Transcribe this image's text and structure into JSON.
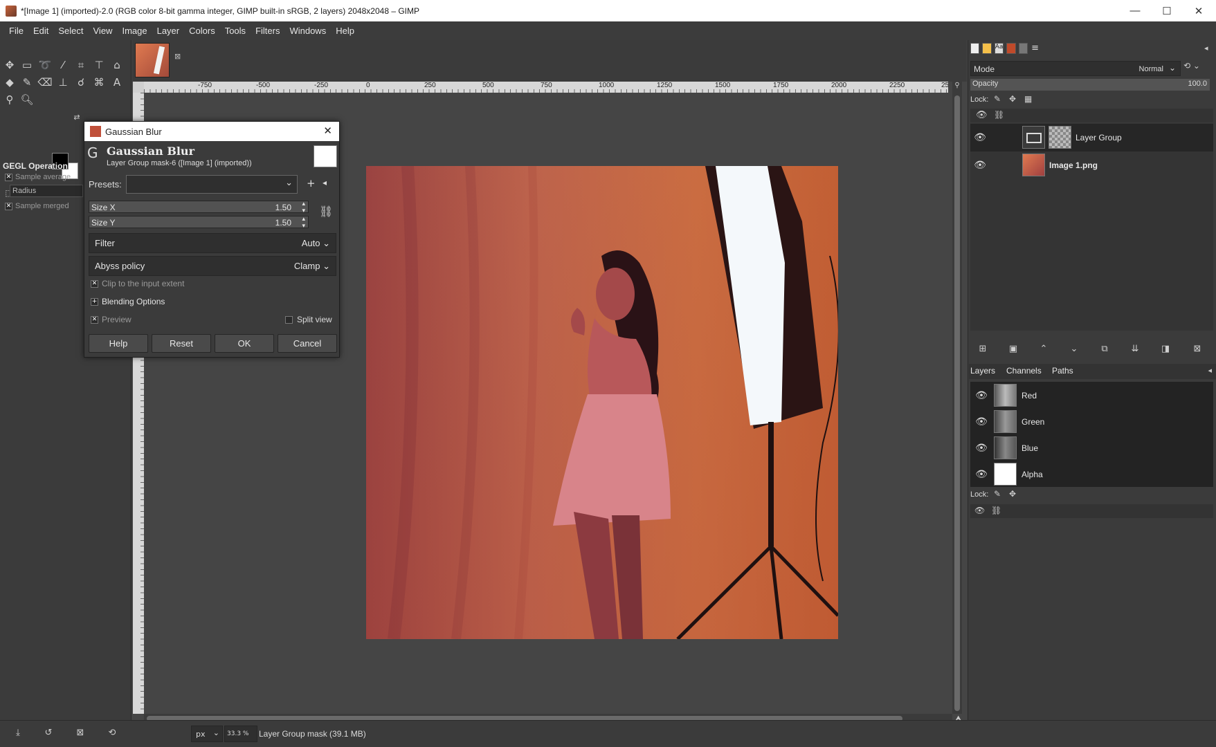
{
  "window": {
    "title": "*[Image 1] (imported)-2.0 (RGB color 8-bit gamma integer, GIMP built-in sRGB, 2 layers) 2048x2048 – GIMP",
    "minimize": "—",
    "maximize": "☐",
    "close": "✕"
  },
  "menu": [
    "File",
    "Edit",
    "Select",
    "View",
    "Image",
    "Layer",
    "Colors",
    "Tools",
    "Filters",
    "Windows",
    "Help"
  ],
  "tool_options": {
    "title": "GEGL Operation",
    "sample_average": "Sample average",
    "radius": "Radius",
    "sample_merged": "Sample merged"
  },
  "ruler_h": [
    "-750",
    "-500",
    "-250",
    "0",
    "250",
    "500",
    "750",
    "1000",
    "1250",
    "1500",
    "1750",
    "2000",
    "2250",
    "25"
  ],
  "dialog": {
    "title": "Gaussian Blur",
    "heading": "Gaussian Blur",
    "subheading": "Layer Group mask-6 ([Image 1] (imported))",
    "presets_label": "Presets:",
    "size_x_label": "Size X",
    "size_x_value": "1.50",
    "size_y_label": "Size Y",
    "size_y_value": "1.50",
    "filter_label": "Filter",
    "filter_value": "Auto",
    "abyss_label": "Abyss policy",
    "abyss_value": "Clamp",
    "clip_label": "Clip to the input extent",
    "blending_label": "Blending Options",
    "preview_label": "Preview",
    "split_view_label": "Split view",
    "help": "Help",
    "reset": "Reset",
    "ok": "OK",
    "cancel": "Cancel"
  },
  "layers_panel": {
    "mode_label": "Mode",
    "mode_value": "Normal",
    "opacity_label": "Opacity",
    "opacity_value": "100.0",
    "lock_label": "Lock:",
    "layers": [
      {
        "name": "Layer Group"
      },
      {
        "name": "Image 1.png"
      }
    ]
  },
  "channels_panel": {
    "tabs": [
      "Layers",
      "Channels",
      "Paths"
    ],
    "channels": [
      {
        "name": "Red"
      },
      {
        "name": "Green"
      },
      {
        "name": "Blue"
      },
      {
        "name": "Alpha"
      }
    ],
    "lock_label": "Lock:"
  },
  "status": {
    "unit": "px",
    "zoom": "33.3 %",
    "message": "Layer Group mask (39.1 MB)"
  },
  "colors": {
    "accent_orange": "#e8783c",
    "panel_dark": "#3b3b3b",
    "canvas_bg": "#454545"
  }
}
